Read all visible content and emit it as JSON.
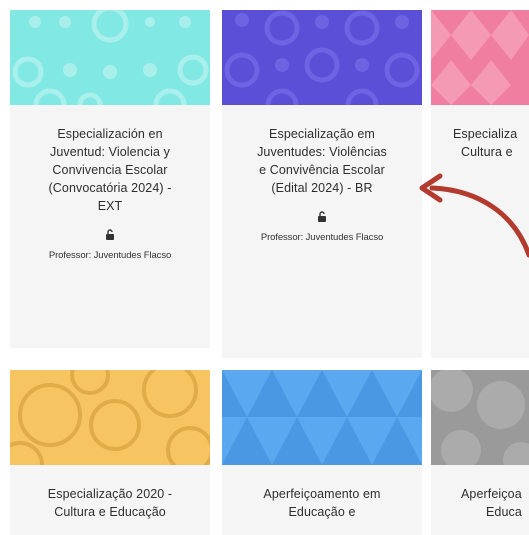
{
  "courses": [
    {
      "title_lines": [
        "Especialización en",
        "Juventud: Violencia y",
        "Convivencia Escolar",
        "(Convocatória 2024) -",
        "EXT"
      ],
      "professor": "Professor: Juventudes Flacso",
      "banner_color": "#82e8e4",
      "banner_pattern": "circles"
    },
    {
      "title_lines": [
        "Especialização em",
        "Juventudes: Violências",
        "e Convivência Escolar",
        "(Edital 2024) - BR"
      ],
      "professor": "Professor: Juventudes Flacso",
      "banner_color": "#5b4fd8",
      "banner_pattern": "circles"
    },
    {
      "title_lines": [
        "Especializa",
        "Cultura e"
      ],
      "banner_color": "#f07ea0",
      "banner_pattern": "diamonds"
    },
    {
      "title_lines": [
        "Especialização 2020 -",
        "Cultura e Educação"
      ],
      "banner_color": "#f6c460",
      "banner_pattern": "rings"
    },
    {
      "title_lines": [
        "Aperfeiçoamento em",
        "Educação e"
      ],
      "banner_color": "#5aa8ef",
      "banner_pattern": "triangles"
    },
    {
      "title_lines": [
        "Aperfeiçoa",
        "Educa"
      ],
      "banner_color": "#9a9a9a",
      "banner_pattern": "circles"
    }
  ],
  "icons": {
    "lock": "unlock-icon",
    "annotation": "red-curved-arrow"
  },
  "colors": {
    "arrow": "#b23a2e"
  }
}
